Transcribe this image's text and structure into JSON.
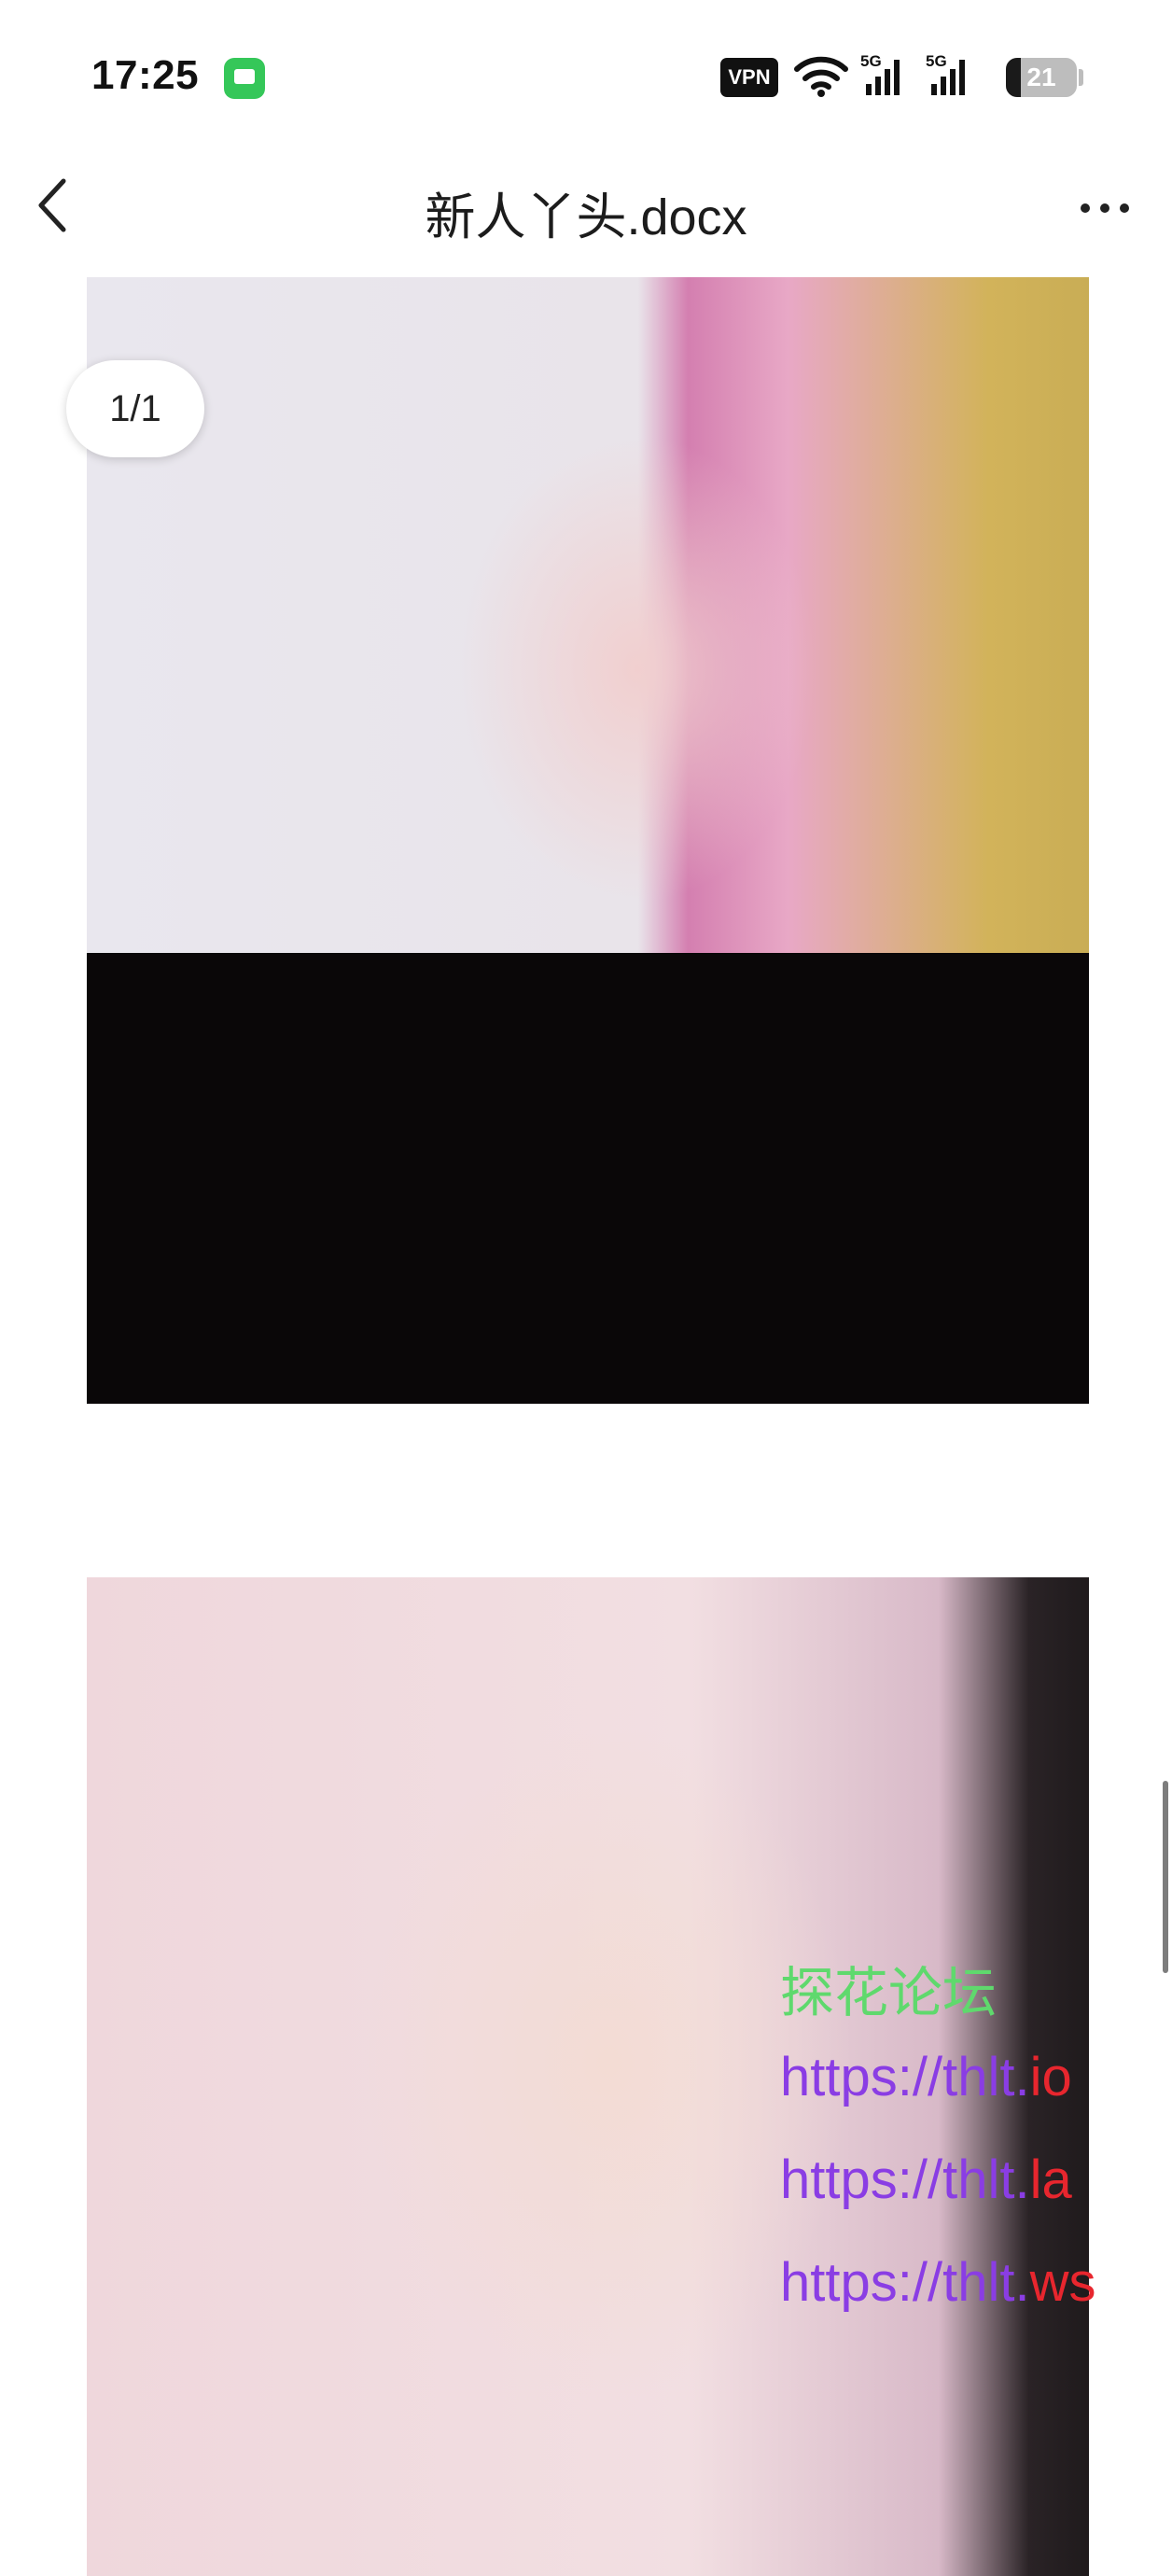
{
  "status_bar": {
    "time": "17:25",
    "vpn_label": "VPN",
    "signal_1_label": "5G",
    "signal_2_label": "5G",
    "battery_level": "21"
  },
  "header": {
    "title": "新人丫头.docx"
  },
  "document": {
    "page_indicator": "1/1",
    "watermark": {
      "forum": "探花论坛",
      "link_1": {
        "prefix": "https://thlt.",
        "suffix": "io"
      },
      "link_2": {
        "prefix": "https://thlt.",
        "suffix": "la"
      },
      "link_3": {
        "prefix": "https://thlt.",
        "suffix": "ws"
      }
    }
  },
  "colors": {
    "watermark_green": "#5fd96d",
    "watermark_purple": "#8a3de4",
    "watermark_red": "#e8262e",
    "messages_app_green": "#35c759"
  },
  "icons": [
    "messages-app-icon",
    "vpn-icon",
    "wifi-icon",
    "signal-icon",
    "battery-icon",
    "back-icon",
    "more-icon"
  ]
}
